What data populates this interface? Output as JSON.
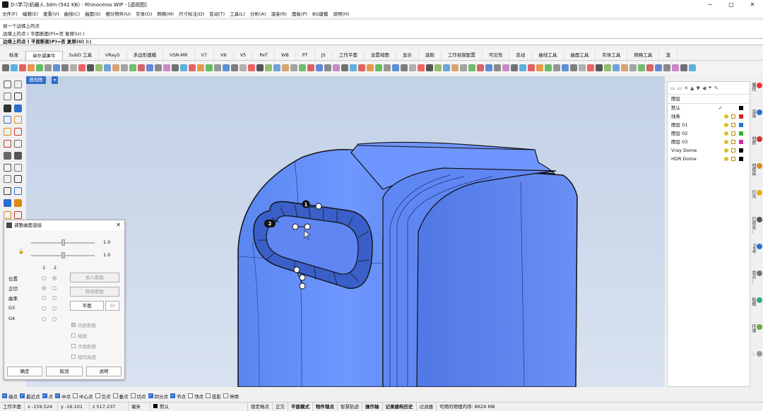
{
  "window": {
    "title": "D:\\学习\\机器人.3dm (541 KB) - Rhinoceros WIP - [透视图]",
    "min": "─",
    "max": "□",
    "close": "✕"
  },
  "menu": [
    "文件(F)",
    "编辑(E)",
    "查看(V)",
    "曲线(C)",
    "曲面(S)",
    "细分物件(U)",
    "实体(O)",
    "网格(M)",
    "尺寸标注(D)",
    "变动(T)",
    "工具(L)",
    "分析(A)",
    "渲染(R)",
    "面板(P)",
    "BG建模",
    "说明(H)"
  ],
  "command": {
    "history": [
      "另一个边缘上的点",
      "边缘上的点 ( 平面断面(P)=否  复原(U) )"
    ],
    "prompt": "边缘上的点 ( 平面断面(P)=否  复原(U) ):"
  },
  "tabs": [
    "标准",
    "卓尔谟果牛",
    "SubD 工具",
    "VRay5",
    "多边形建模",
    "VSR-MR",
    "V7",
    "V6",
    "V5",
    "PeT",
    "WB",
    "PT",
    "JS",
    "工作平面",
    "设置视图",
    "显示",
    "选取",
    "工作视窗配置",
    "可见性",
    "变动",
    "曲线工具",
    "曲面工具",
    "实体工具",
    "网格工具",
    "渲"
  ],
  "active_tab": "卓尔谟果牛",
  "viewport": {
    "label": "透视图",
    "arrow": "▾",
    "markers": [
      "1",
      "2"
    ]
  },
  "layers": {
    "header": "图层",
    "items": [
      {
        "name": "默认",
        "color": "#000000",
        "current": true
      },
      {
        "name": "线条",
        "color": "#e02020"
      },
      {
        "name": "图层 01",
        "color": "#1a74d8"
      },
      {
        "name": "图层 02",
        "color": "#2fb52f"
      },
      {
        "name": "图层 03",
        "color": "#d22ab0"
      },
      {
        "name": "Vray Dome",
        "color": "#000000"
      },
      {
        "name": "HDR Dome",
        "color": "#000000"
      }
    ],
    "check": "✓"
  },
  "side_tabs": [
    "属性",
    "渲染",
    "材质",
    "材质库",
    "灯光",
    "已命名…",
    "Help",
    "显示…",
    "贴图",
    "环境",
    "..."
  ],
  "dialog": {
    "title": "调整曲面混接",
    "slider1": "1.0",
    "slider2": "1.0",
    "col1": "1",
    "col2": "2",
    "rows": [
      "位置",
      "正切",
      "曲率",
      "G3",
      "G4"
    ],
    "add_section": "加入断面",
    "remove_section": "移除断面",
    "planar": "平面",
    "planar_value": "30",
    "checks": [
      "内部断面",
      "縮樣",
      "平面断面",
      "相同高度"
    ],
    "ok": "确定",
    "cancel": "取消",
    "help": "说明"
  },
  "snaps": [
    {
      "l": "端点",
      "on": true
    },
    {
      "l": "最近点",
      "on": true
    },
    {
      "l": "点",
      "on": true
    },
    {
      "l": "中点",
      "on": true
    },
    {
      "l": "中心点",
      "on": false
    },
    {
      "l": "交点",
      "on": false
    },
    {
      "l": "垂点",
      "on": false
    },
    {
      "l": "切点",
      "on": false
    },
    {
      "l": "四分点",
      "on": true
    },
    {
      "l": "节点",
      "on": true
    },
    {
      "l": "顶点",
      "on": false
    },
    {
      "l": "投影",
      "on": false
    },
    {
      "l": "停用",
      "on": false
    }
  ],
  "status": {
    "plane": "工作平面",
    "x": "x -159.524",
    "y": "y -16.101",
    "z": "z 517.237",
    "unit": "毫米",
    "layer": "默认",
    "toggles": [
      "锁定格点",
      "正交",
      "平面模式",
      "物件锁点",
      "智慧轨迹",
      "操作轴",
      "记录建构历史",
      "过滤器"
    ],
    "memory": "可用的物理内存: 8629 MB"
  }
}
